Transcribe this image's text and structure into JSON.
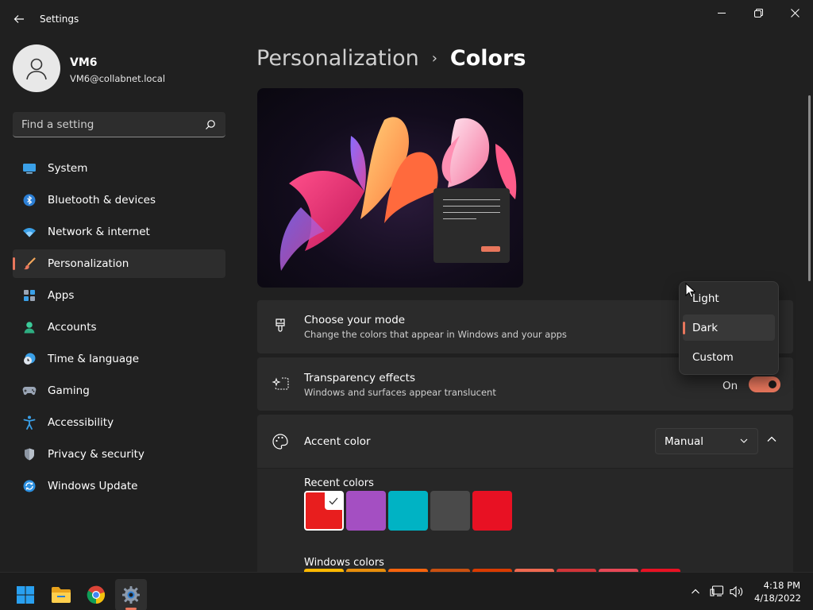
{
  "window": {
    "title": "Settings"
  },
  "profile": {
    "name": "VM6",
    "email": "VM6@collabnet.local"
  },
  "search": {
    "placeholder": "Find a setting"
  },
  "nav": {
    "items": [
      {
        "label": "System",
        "icon": "system-icon"
      },
      {
        "label": "Bluetooth & devices",
        "icon": "bluetooth-icon"
      },
      {
        "label": "Network & internet",
        "icon": "wifi-icon"
      },
      {
        "label": "Personalization",
        "icon": "brush-icon",
        "active": true
      },
      {
        "label": "Apps",
        "icon": "apps-icon"
      },
      {
        "label": "Accounts",
        "icon": "accounts-icon"
      },
      {
        "label": "Time & language",
        "icon": "time-language-icon"
      },
      {
        "label": "Gaming",
        "icon": "gaming-icon"
      },
      {
        "label": "Accessibility",
        "icon": "accessibility-icon"
      },
      {
        "label": "Privacy & security",
        "icon": "shield-icon"
      },
      {
        "label": "Windows Update",
        "icon": "update-icon"
      }
    ]
  },
  "breadcrumb": {
    "parent": "Personalization",
    "separator": "›",
    "current": "Colors"
  },
  "mode": {
    "title": "Choose your mode",
    "description": "Change the colors that appear in Windows and your apps"
  },
  "transparency": {
    "title": "Transparency effects",
    "description": "Windows and surfaces appear translucent",
    "state_label": "On",
    "enabled": true
  },
  "accent": {
    "title": "Accent color",
    "selected": "Manual",
    "recent_label": "Recent colors",
    "recent_colors": [
      "#e81e1e",
      "#a44fc2",
      "#00b3c4",
      "#4a4a4a",
      "#e81123"
    ],
    "windows_label": "Windows colors",
    "windows_colors": [
      "#ffb900",
      "#e78d0b",
      "#f7630c",
      "#ca5010",
      "#da3b01",
      "#ef6950",
      "#d13438",
      "#e74856",
      "#e81123"
    ]
  },
  "mode_dropdown": {
    "options": [
      "Light",
      "Dark",
      "Custom"
    ],
    "selected": "Dark"
  },
  "taskbar": {
    "time": "4:18 PM",
    "date": "4/18/2022"
  },
  "colors": {
    "accent": "#e8765c",
    "background": "#202020",
    "card": "#2b2b2b"
  }
}
